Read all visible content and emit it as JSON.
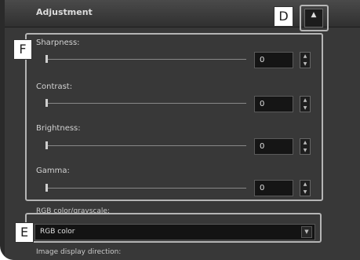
{
  "panel": {
    "title": "Adjustment",
    "collapse_icon": "chevron-up-icon",
    "collapse_glyph": "▲"
  },
  "callouts": {
    "d": "D",
    "f": "F",
    "e": "E"
  },
  "sliders": [
    {
      "label": "Sharpness:",
      "value": "0"
    },
    {
      "label": "Contrast:",
      "value": "0"
    },
    {
      "label": "Brightness:",
      "value": "0"
    },
    {
      "label": "Gamma:",
      "value": "0"
    }
  ],
  "spinner": {
    "up_glyph": "▲",
    "down_glyph": "▼"
  },
  "color_mode": {
    "label": "RGB color/grayscale:",
    "selected": "RGB color",
    "arrow_glyph": "▼"
  },
  "display_direction": {
    "label": "Image display direction:"
  },
  "colors": {
    "panel_bg": "#383838",
    "highlight": "#b5b5b5",
    "field_bg": "#151515"
  }
}
